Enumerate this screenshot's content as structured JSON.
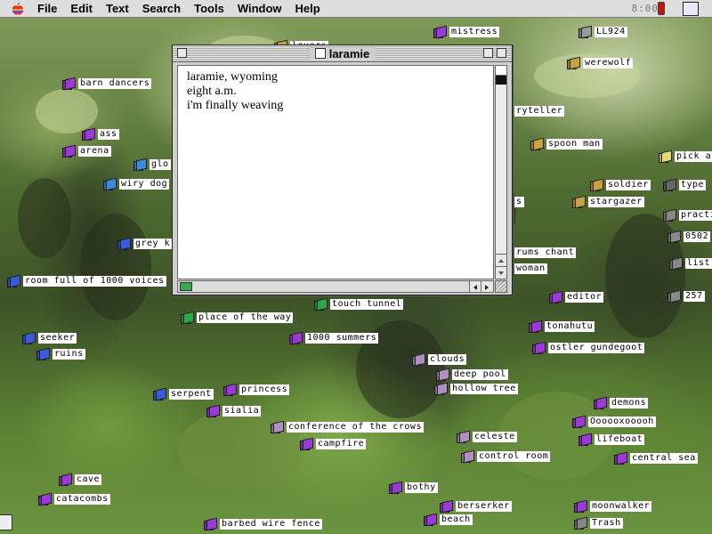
{
  "menubar": {
    "items": [
      "File",
      "Edit",
      "Text",
      "Search",
      "Tools",
      "Window",
      "Help"
    ],
    "clock": "8:00"
  },
  "window": {
    "title": "laramie",
    "lines": [
      "laramie, wyoming",
      "eight a.m.",
      "",
      "i'm finally weaving"
    ]
  },
  "desktop_icons": [
    {
      "label": "mistress",
      "color": "#9a3ad8"
    },
    {
      "label": "LL924",
      "color": "#9a9a9a"
    },
    {
      "label": "werewolf",
      "color": "#c9a23a"
    },
    {
      "label": "barn dancers",
      "color": "#9a3ad8"
    },
    {
      "label": "ryteller",
      "color": "#c9a23a"
    },
    {
      "label": "ass",
      "color": "#9a3ad8"
    },
    {
      "label": "arena",
      "color": "#9a3ad8"
    },
    {
      "label": "spoon man",
      "color": "#c9a23a"
    },
    {
      "label": "pick a",
      "color": "#e8d870"
    },
    {
      "label": "glo",
      "color": "#3a8ad8"
    },
    {
      "label": "soldier",
      "color": "#c9a23a"
    },
    {
      "label": "type",
      "color": "#666666"
    },
    {
      "label": "wiry dog",
      "color": "#3a8ad8"
    },
    {
      "label": "stargazer",
      "color": "#c9a23a"
    },
    {
      "label": "s",
      "color": "#c9a23a"
    },
    {
      "label": "practi",
      "color": "#888888"
    },
    {
      "label": "0502",
      "color": "#888888"
    },
    {
      "label": "grey k",
      "color": "#3a5ad8"
    },
    {
      "label": "rums chant",
      "color": "#c9a23a"
    },
    {
      "label": "list",
      "color": "#888888"
    },
    {
      "label": "woman",
      "color": "#c9a23a"
    },
    {
      "label": "room full of 1000 voices",
      "color": "#3a5ad8"
    },
    {
      "label": "editor",
      "color": "#9a3ad8"
    },
    {
      "label": "257",
      "color": "#888888"
    },
    {
      "label": "touch tunnel",
      "color": "#2aa84a"
    },
    {
      "label": "place of the way",
      "color": "#2aa84a"
    },
    {
      "label": "tonahutu",
      "color": "#9a3ad8"
    },
    {
      "label": "seeker",
      "color": "#3a5ad8"
    },
    {
      "label": "1000 summers",
      "color": "#9a3ad8"
    },
    {
      "label": "ostler gundegoot",
      "color": "#9a3ad8"
    },
    {
      "label": "ruins",
      "color": "#3a5ad8"
    },
    {
      "label": "clouds",
      "color": "#b090c0"
    },
    {
      "label": "deep pool",
      "color": "#b090c0"
    },
    {
      "label": "hollow tree",
      "color": "#b090c0"
    },
    {
      "label": "serpent",
      "color": "#3a5ad8"
    },
    {
      "label": "princess",
      "color": "#9a3ad8"
    },
    {
      "label": "demons",
      "color": "#9a3ad8"
    },
    {
      "label": "sialia",
      "color": "#9a3ad8"
    },
    {
      "label": "Oooooxooooh",
      "color": "#9a3ad8"
    },
    {
      "label": "conference of the crows",
      "color": "#b090c0"
    },
    {
      "label": "celeste",
      "color": "#b090c0"
    },
    {
      "label": "lifeboat",
      "color": "#9a3ad8"
    },
    {
      "label": "campfire",
      "color": "#9a3ad8"
    },
    {
      "label": "control room",
      "color": "#b090c0"
    },
    {
      "label": "central sea",
      "color": "#9a3ad8"
    },
    {
      "label": "cave",
      "color": "#9a3ad8"
    },
    {
      "label": "bothy",
      "color": "#9a3ad8"
    },
    {
      "label": "catacombs",
      "color": "#9a3ad8"
    },
    {
      "label": "berserker",
      "color": "#9a3ad8"
    },
    {
      "label": "moonwalker",
      "color": "#9a3ad8"
    },
    {
      "label": "beach",
      "color": "#9a3ad8"
    },
    {
      "label": "barbed wire fence",
      "color": "#9a3ad8"
    },
    {
      "label": "Trash",
      "color": "#888888"
    },
    {
      "label": "lovers",
      "color": "#c9a23a"
    }
  ]
}
